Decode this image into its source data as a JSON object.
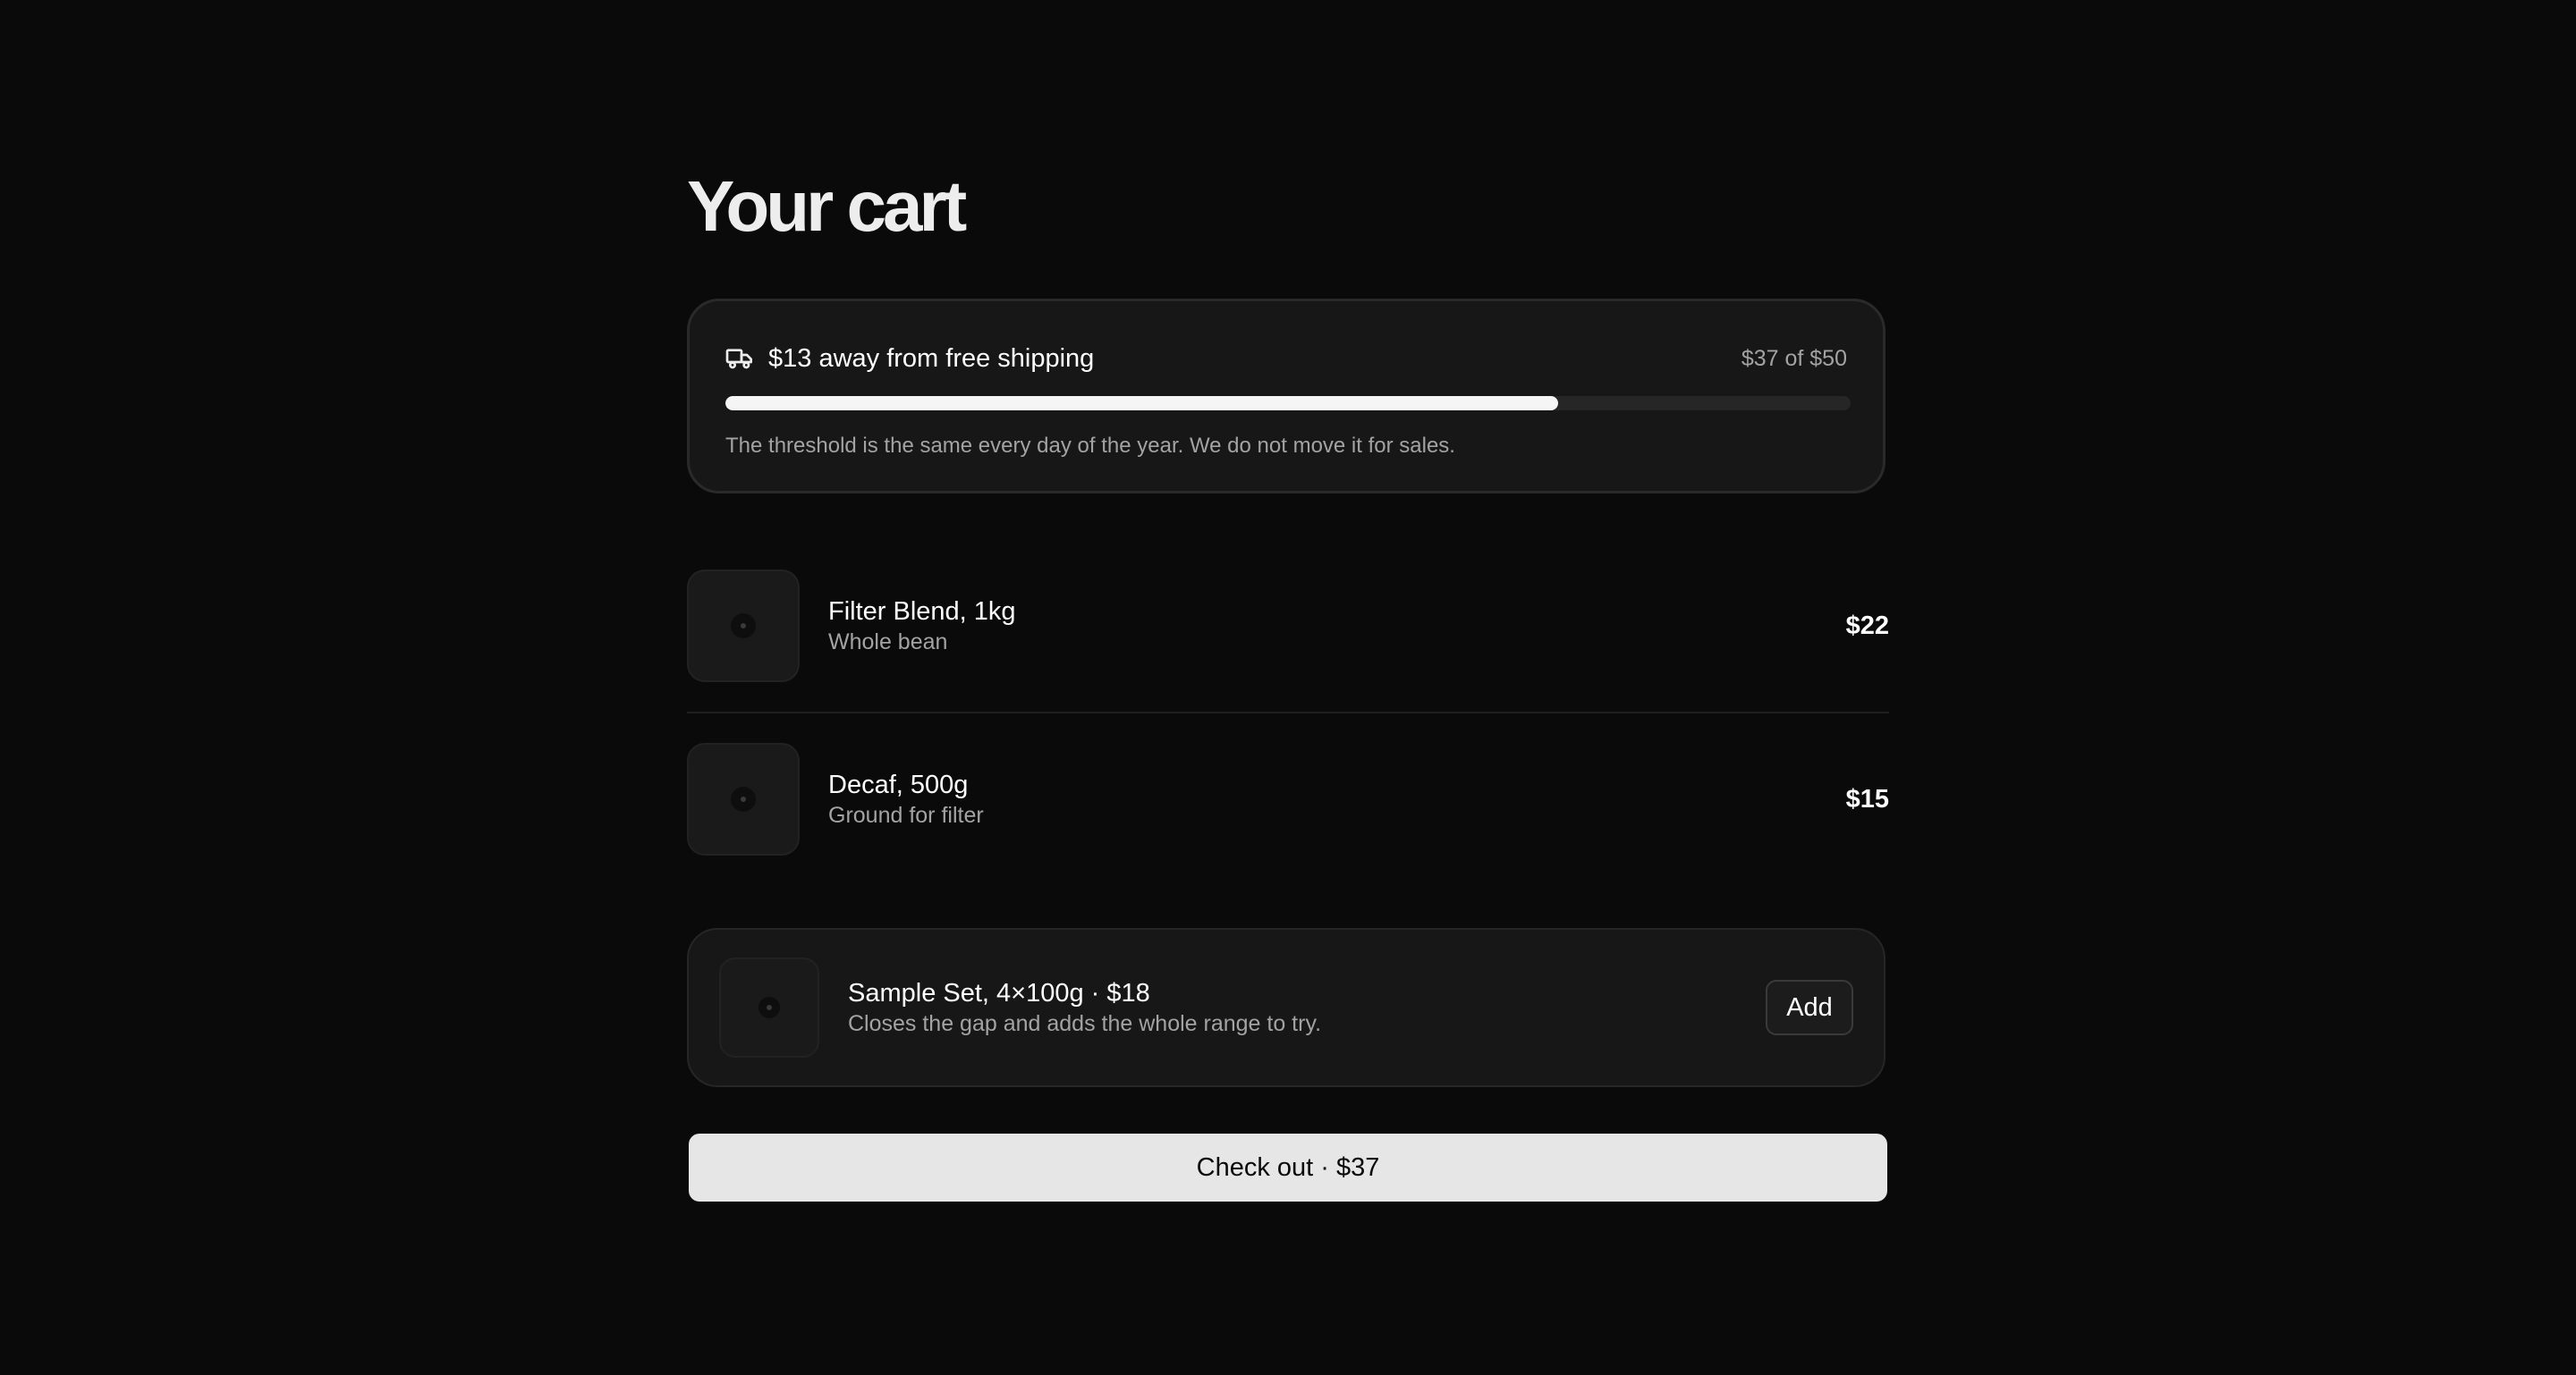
{
  "page": {
    "title": "Your cart"
  },
  "shipping": {
    "message": "$13 away from free shipping",
    "progress_text": "$37 of $50",
    "progress_fraction": 0.74,
    "note": "The threshold is the same every day of the year. We do not move it for sales.",
    "icon": "truck-icon"
  },
  "items": [
    {
      "name": "Filter Blend, 1kg",
      "variant": "Whole bean",
      "price": "$22",
      "icon": "coffee-bag-icon"
    },
    {
      "name": "Decaf, 500g",
      "variant": "Ground for filter",
      "price": "$15",
      "icon": "coffee-bag-icon"
    }
  ],
  "upsell": {
    "title": "Sample Set, 4×100g · $18",
    "description": "Closes the gap and adds the whole range to try.",
    "add_label": "Add",
    "icon": "coffee-bag-icon"
  },
  "checkout": {
    "label": "Check out · $37"
  },
  "colors": {
    "background": "#0a0a0a",
    "card": "#171717",
    "progress_fill": "#f5f5f5",
    "checkout_button": "#e6e6e6"
  }
}
